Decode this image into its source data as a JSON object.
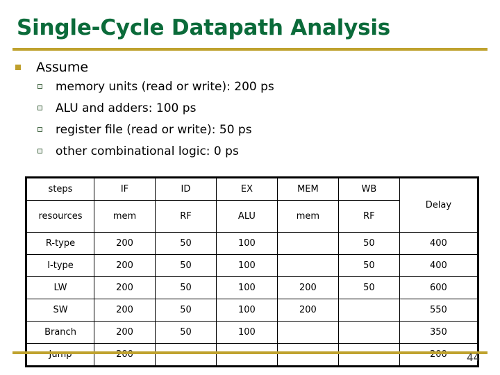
{
  "slide": {
    "title": "Single-Cycle Datapath Analysis",
    "page_number": "44",
    "accent_gold": "#bfa22e",
    "title_green": "#0b6b3a"
  },
  "bullets": {
    "level1": "Assume",
    "level2": [
      "memory units (read or write): 200 ps",
      "ALU and adders: 100 ps",
      "register file (read or write): 50 ps",
      "other combinational logic: 0 ps"
    ]
  },
  "table": {
    "header_steps": [
      "steps",
      "IF",
      "ID",
      "EX",
      "MEM",
      "WB"
    ],
    "header_resources": [
      "resources",
      "mem",
      "RF",
      "ALU",
      "mem",
      "RF"
    ],
    "delay_header": "Delay",
    "rows": [
      {
        "label": "R-type",
        "IF": "200",
        "ID": "50",
        "EX": "100",
        "MEM": "",
        "WB": "50",
        "delay": "400"
      },
      {
        "label": "I-type",
        "IF": "200",
        "ID": "50",
        "EX": "100",
        "MEM": "",
        "WB": "50",
        "delay": "400"
      },
      {
        "label": "LW",
        "IF": "200",
        "ID": "50",
        "EX": "100",
        "MEM": "200",
        "WB": "50",
        "delay": "600"
      },
      {
        "label": "SW",
        "IF": "200",
        "ID": "50",
        "EX": "100",
        "MEM": "200",
        "WB": "",
        "delay": "550"
      },
      {
        "label": "Branch",
        "IF": "200",
        "ID": "50",
        "EX": "100",
        "MEM": "",
        "WB": "",
        "delay": "350"
      },
      {
        "label": "Jump",
        "IF": "200",
        "ID": "",
        "EX": "",
        "MEM": "",
        "WB": "",
        "delay": "200"
      }
    ]
  }
}
